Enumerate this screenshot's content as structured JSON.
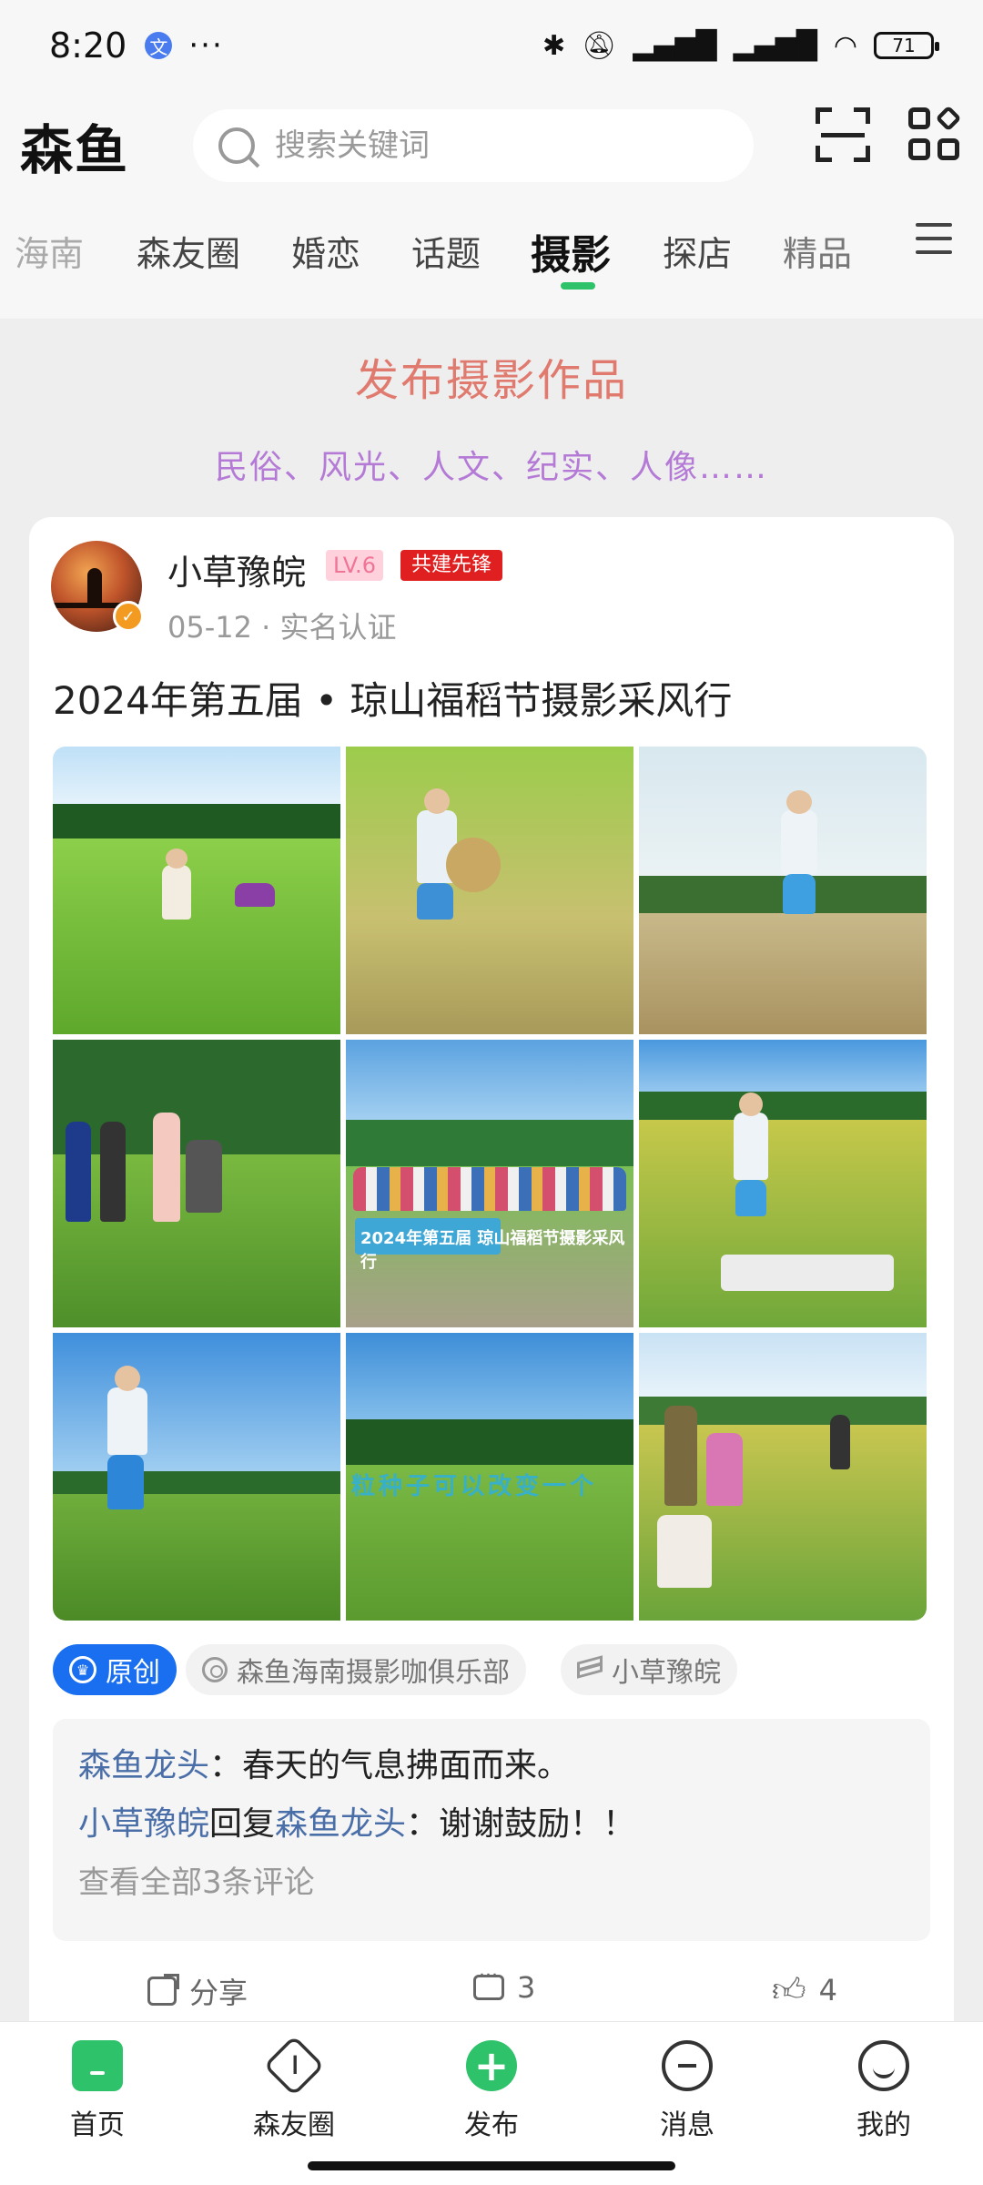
{
  "status": {
    "time": "8:20",
    "app_icon": "文",
    "more": "···",
    "battery": "71",
    "icons": [
      "bluetooth-icon",
      "mute-icon",
      "signal-hd-icon",
      "signal-hd-icon-2",
      "wifi-icon"
    ]
  },
  "header": {
    "logo": "森鱼",
    "search_placeholder": "搜索关键词"
  },
  "tabs": [
    {
      "label": "海南"
    },
    {
      "label": "森友圈"
    },
    {
      "label": "婚恋"
    },
    {
      "label": "话题"
    },
    {
      "label": "摄影"
    },
    {
      "label": "探店"
    },
    {
      "label": "精品"
    }
  ],
  "active_tab": "摄影",
  "banner": {
    "title": "发布摄影作品",
    "subtitle": "民俗、风光、人文、纪实、人像……"
  },
  "post": {
    "username": "小草豫皖",
    "level": "LV.6",
    "badge": "共建先锋",
    "date": "05-12",
    "separator": "·",
    "verification": "实名认证",
    "title": "2024年第五届 • 琼山福稻节摄影采风行",
    "photo_banner_text": "2024年第五届 琼山福稻节摄影采风行",
    "photo_slogan": "粒种子可以改变一个",
    "tags": {
      "original": "原创",
      "club": "森鱼海南摄影咖俱乐部",
      "author": "小草豫皖"
    },
    "comments": [
      {
        "name": "森鱼龙头",
        "sep": "：",
        "text": "春天的气息拂面而来。"
      },
      {
        "name": "小草豫皖",
        "verb": "回复",
        "target": "森鱼龙头",
        "sep": "：",
        "text": "谢谢鼓励！！"
      }
    ],
    "view_all": "查看全部3条评论",
    "actions": {
      "share": "分享",
      "comments": "3",
      "likes": "4"
    }
  },
  "bottom_nav": [
    {
      "label": "首页"
    },
    {
      "label": "森友圈"
    },
    {
      "label": "发布"
    },
    {
      "label": "消息"
    },
    {
      "label": "我的"
    }
  ],
  "colors": {
    "accent_green": "#2ec26a",
    "banner_title": "#e07a6e",
    "banner_subtitle": "#b47ad6",
    "link_blue": "#4a6ea8",
    "badge_red": "#e02020",
    "original_blue": "#1a6ff0"
  }
}
